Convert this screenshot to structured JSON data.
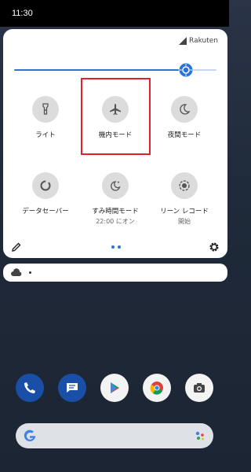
{
  "status_bar": {
    "time": "11:30"
  },
  "quick_settings": {
    "carrier": "Rakuten",
    "brightness_level": 0.85,
    "tiles": [
      {
        "name": "flashlight",
        "label": "ライト",
        "icon": "flashlight-icon"
      },
      {
        "name": "airplane",
        "label": "機内モード",
        "icon": "airplane-icon"
      },
      {
        "name": "night-mode",
        "label": "夜間モード",
        "icon": "moon-icon"
      },
      {
        "name": "data-saver",
        "label": "データセーバー",
        "icon": "data-saver-icon"
      },
      {
        "name": "bedtime",
        "label": "すみ時間モード",
        "sublabel": "22:00 にオン",
        "icon": "bedtime-icon"
      },
      {
        "name": "screen-record",
        "label": "リーン レコード",
        "sublabel": "開始",
        "icon": "screen-record-icon"
      }
    ],
    "page_indicator": {
      "pages": 2,
      "current": 1
    }
  },
  "colors": {
    "accent": "#2a74d8",
    "tile_bg": "#dcdcdc",
    "highlight": "#e0202e"
  },
  "dock": {
    "apps": [
      "phone-icon",
      "messages-icon",
      "play-store-icon",
      "chrome-icon",
      "camera-icon"
    ]
  }
}
